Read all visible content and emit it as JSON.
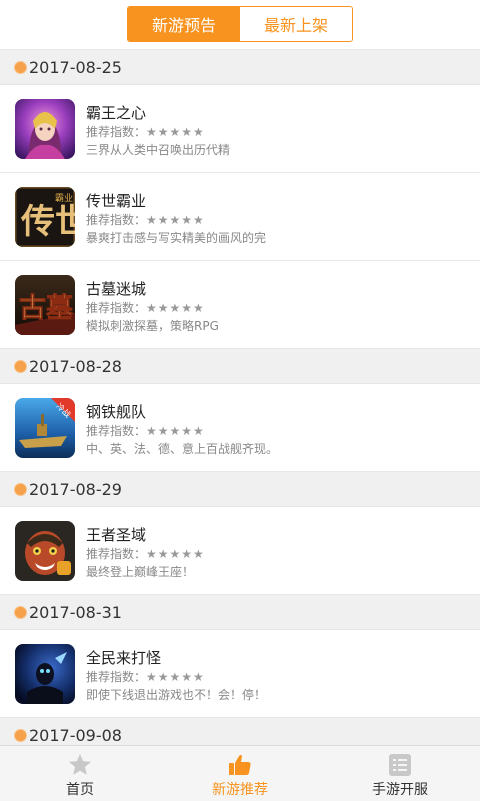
{
  "top_tabs": {
    "tab1": "新游预告",
    "tab2": "最新上架"
  },
  "rating_label": "推荐指数：",
  "sections": [
    {
      "date": "2017-08-25",
      "games": [
        {
          "name": "霸王之心",
          "stars": "★★★★★",
          "desc": "三界从人类中召唤出历代精"
        },
        {
          "name": "传世霸业",
          "stars": "★★★★★",
          "desc": "暴爽打击感与写实精美的画风的完"
        },
        {
          "name": "古墓迷城",
          "stars": "★★★★★",
          "desc": "模拟刺激探墓，策略RPG"
        }
      ]
    },
    {
      "date": "2017-08-28",
      "games": [
        {
          "name": "钢铁舰队",
          "stars": "★★★★★",
          "desc": "中、英、法、德、意上百战舰齐现。"
        }
      ]
    },
    {
      "date": "2017-08-29",
      "games": [
        {
          "name": "王者圣域",
          "stars": "★★★★★",
          "desc": "最终登上巅峰王座！"
        }
      ]
    },
    {
      "date": "2017-08-31",
      "games": [
        {
          "name": "全民来打怪",
          "stars": "★★★★★",
          "desc": "即使下线退出游戏也不！会！停！"
        }
      ]
    },
    {
      "date": "2017-09-08",
      "games": []
    }
  ],
  "icon_text": {
    "g2": "传世",
    "g2_small": "霸业",
    "g3": "古墓",
    "g4_badge": "冷战"
  },
  "bottom_tabs": {
    "home": "首页",
    "recommend": "新游推荐",
    "servers": "手游开服"
  },
  "colors": {
    "accent": "#f7931e",
    "date_dot": "#f6a14b"
  }
}
